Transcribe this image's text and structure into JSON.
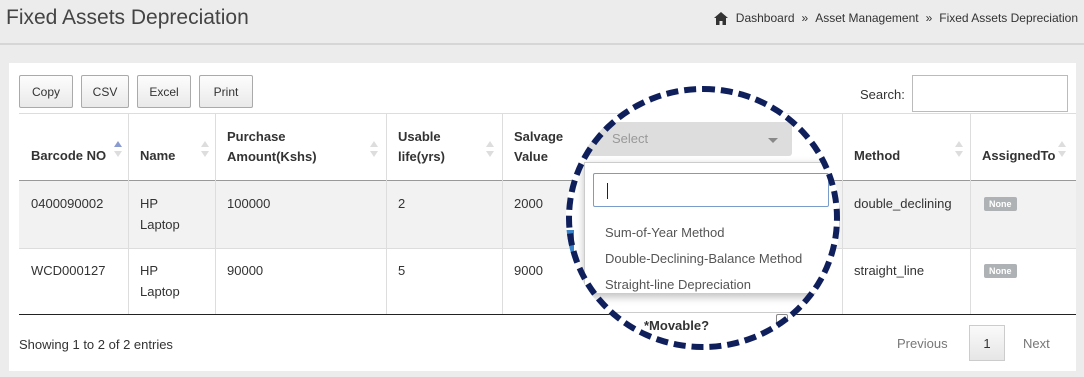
{
  "page": {
    "title": "Fixed Assets Depreciation",
    "breadcrumb": [
      "Dashboard",
      "Asset Management",
      "Fixed Assets Depreciation"
    ],
    "breadcrumb_separator": "»"
  },
  "toolbar": {
    "buttons": [
      "Copy",
      "CSV",
      "Excel",
      "Print"
    ],
    "search_label": "Search:",
    "search_value": ""
  },
  "table": {
    "columns": [
      "Barcode NO",
      "Name",
      "Purchase Amount(Kshs)",
      "Usable life(yrs)",
      "Salvage Value",
      "Method",
      "AssignedTo"
    ],
    "rows": [
      {
        "barcode": "0400090002",
        "name": "HP Laptop",
        "purchase_amount": "100000",
        "usable_life": "2",
        "salvage_value": "2000",
        "method": "double_declining",
        "assigned_to": "None"
      },
      {
        "barcode": "WCD000127",
        "name": "HP Laptop",
        "purchase_amount": "90000",
        "usable_life": "5",
        "salvage_value": "9000",
        "method": "straight_line",
        "assigned_to": "None"
      }
    ]
  },
  "footer": {
    "info": "Showing 1 to 2 of 2 entries",
    "previous": "Previous",
    "current_page": "1",
    "next": "Next"
  },
  "overlay": {
    "select_placeholder": "Select",
    "options": [
      "Sum-of-Year Method",
      "Double-Declining-Balance Method",
      "Straight-line Depreciation"
    ],
    "movable_label": "*Movable?"
  },
  "colors": {
    "accent_blue": "#3b83c8",
    "ring": "#0f1f5c",
    "badge": "#aeb2b5"
  }
}
